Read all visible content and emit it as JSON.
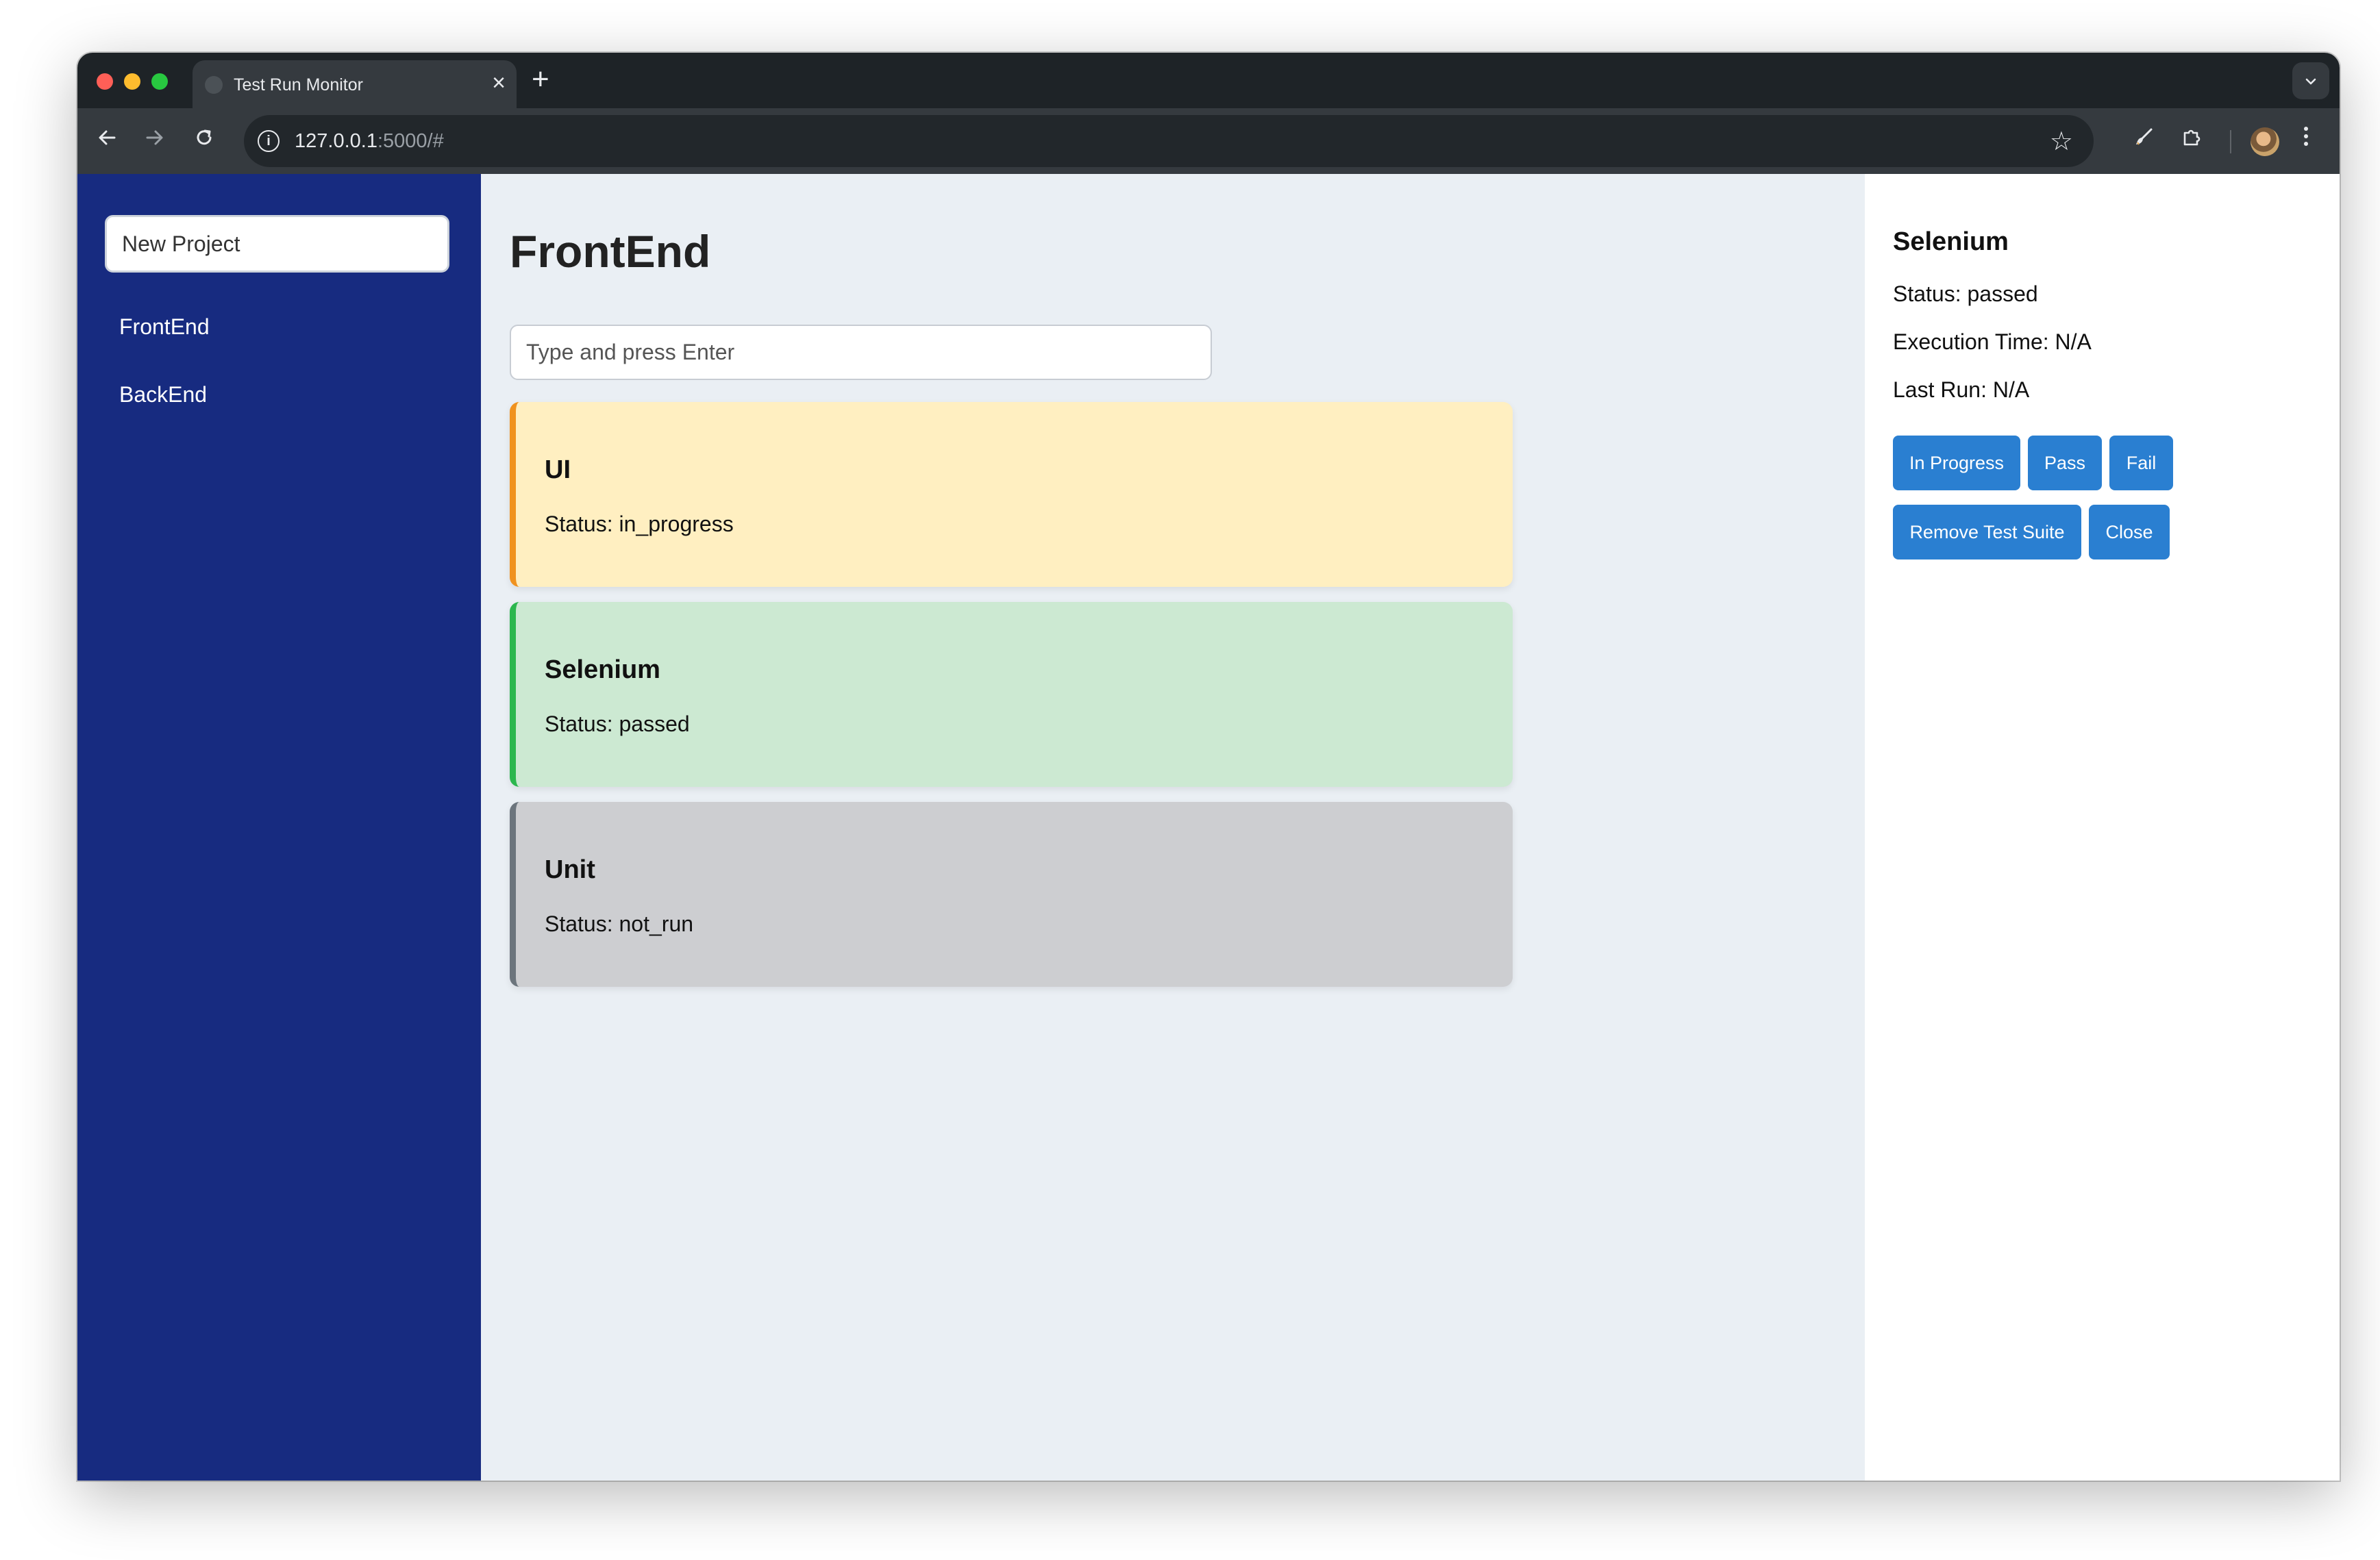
{
  "browser": {
    "tab_title": "Test Run Monitor",
    "tab_close": "×",
    "new_tab": "+",
    "tab_menu": "⌄",
    "url_host": "127.0.0.1",
    "url_rest": ":5000/#",
    "icons": [
      "back-icon",
      "forward-icon",
      "reload-icon",
      "info-icon",
      "star-icon",
      "brush-icon",
      "extensions-icon",
      "avatar",
      "more-icon"
    ]
  },
  "sidebar": {
    "new_project_placeholder": "New Project",
    "projects": [
      {
        "label": "FrontEnd"
      },
      {
        "label": "BackEnd"
      }
    ]
  },
  "main": {
    "title": "FrontEnd",
    "suite_input_placeholder": "Type and press Enter",
    "suites": [
      {
        "name": "UI",
        "status": "Status: in_progress",
        "color": "#f0921e"
      },
      {
        "name": "Selenium",
        "status": "Status: passed",
        "color": "#2cb74e"
      },
      {
        "name": "Unit",
        "status": "Status: not_run",
        "color": "#6c757d"
      }
    ]
  },
  "detail": {
    "title": "Selenium",
    "status": "Status: passed",
    "execution_time": "Execution Time: N/A",
    "last_run": "Last Run: N/A",
    "buttons": {
      "in_progress": "In Progress",
      "pass": "Pass",
      "fail": "Fail",
      "remove": "Remove Test Suite",
      "close": "Close"
    }
  },
  "colors": {
    "sidebar_bg": "#172b80",
    "button_bg": "#2a7fd1",
    "main_bg": "#eaeff4"
  }
}
